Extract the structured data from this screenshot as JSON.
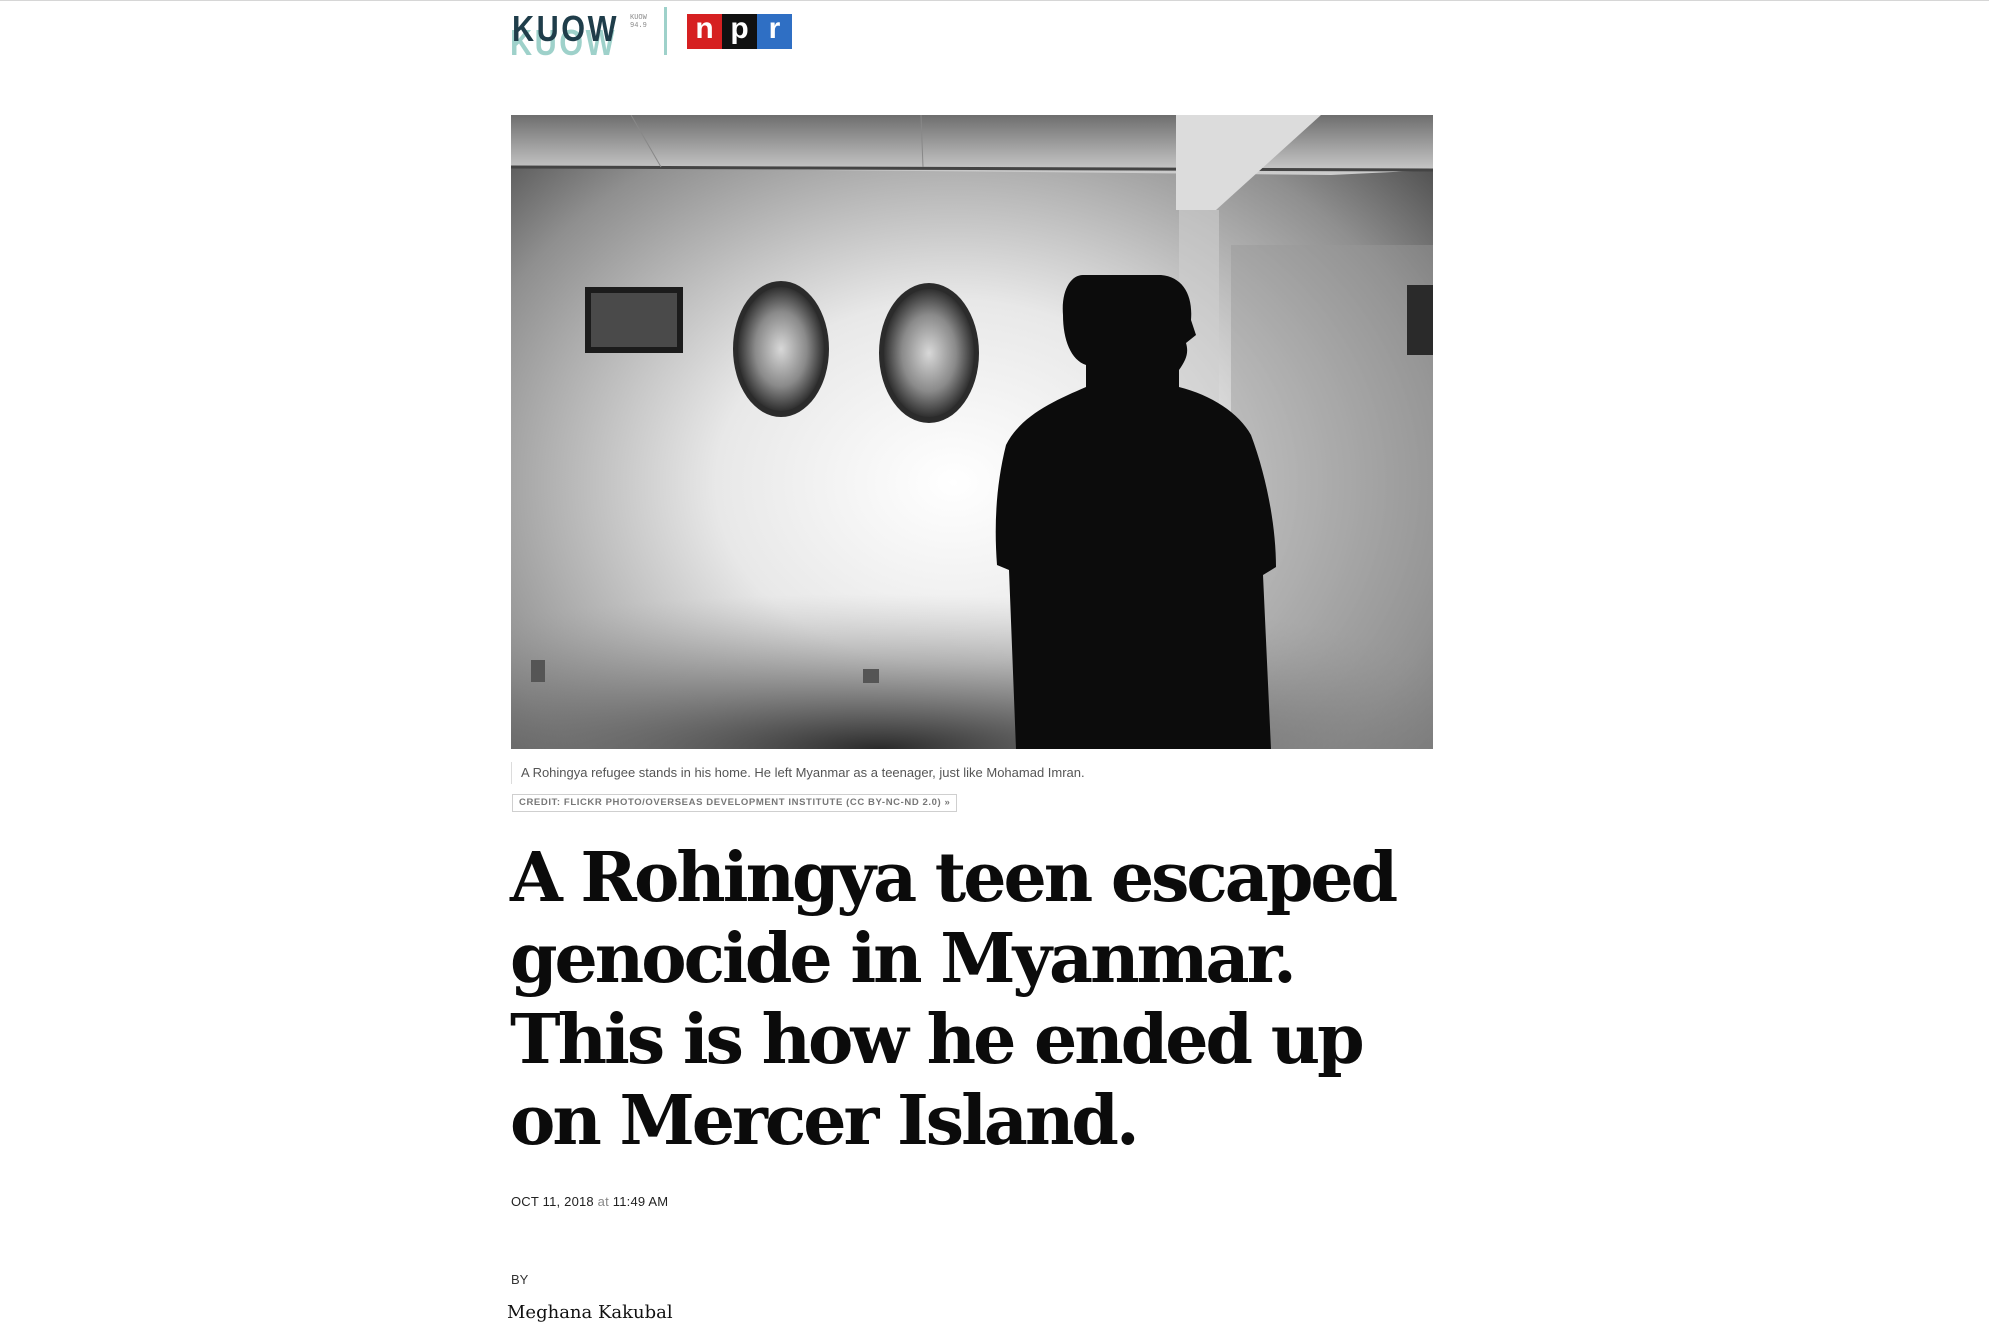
{
  "header": {
    "station_logo": "KUOW",
    "station_freq": "KUOW 94.9",
    "npr_logo": [
      "n",
      "p",
      "r"
    ]
  },
  "photo": {
    "caption": "A Rohingya refugee stands in his home. He left Myanmar as a teenager, just like Mohamad Imran.",
    "credit": "CREDIT: FLICKR PHOTO/OVERSEAS DEVELOPMENT INSTITUTE (CC BY-NC-ND 2.0) »"
  },
  "article": {
    "headline": "A Rohingya teen escaped genocide in Myanmar. This is how he ended up on Mercer Island.",
    "date": "OCT 11, 2018",
    "at": "at",
    "time": "11:49 AM",
    "by_label": "BY",
    "author": "Meghana Kakubal"
  },
  "colors": {
    "kuow_teal": "#9ed1ca",
    "kuow_navy": "#1f3d4a",
    "npr_red": "#d62021",
    "npr_black": "#111111",
    "npr_blue": "#2f6fc4"
  }
}
